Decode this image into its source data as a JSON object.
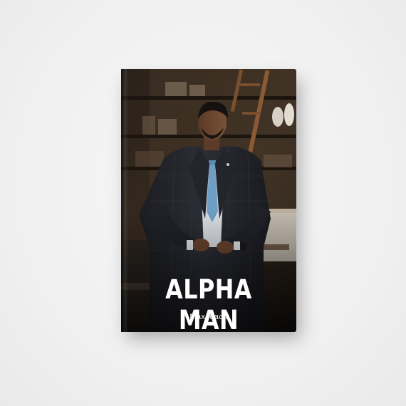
{
  "book": {
    "title": "ALPHA MAN",
    "author": "Maxcoach"
  },
  "colors": {
    "background": "#f3f3f3",
    "cover_dark": "#2b2119",
    "suit": "#25272e",
    "tie": "#6f9ec4",
    "title_text": "#ffffff"
  },
  "icons": {
    "cover_photo": "man-in-suit-photo"
  }
}
